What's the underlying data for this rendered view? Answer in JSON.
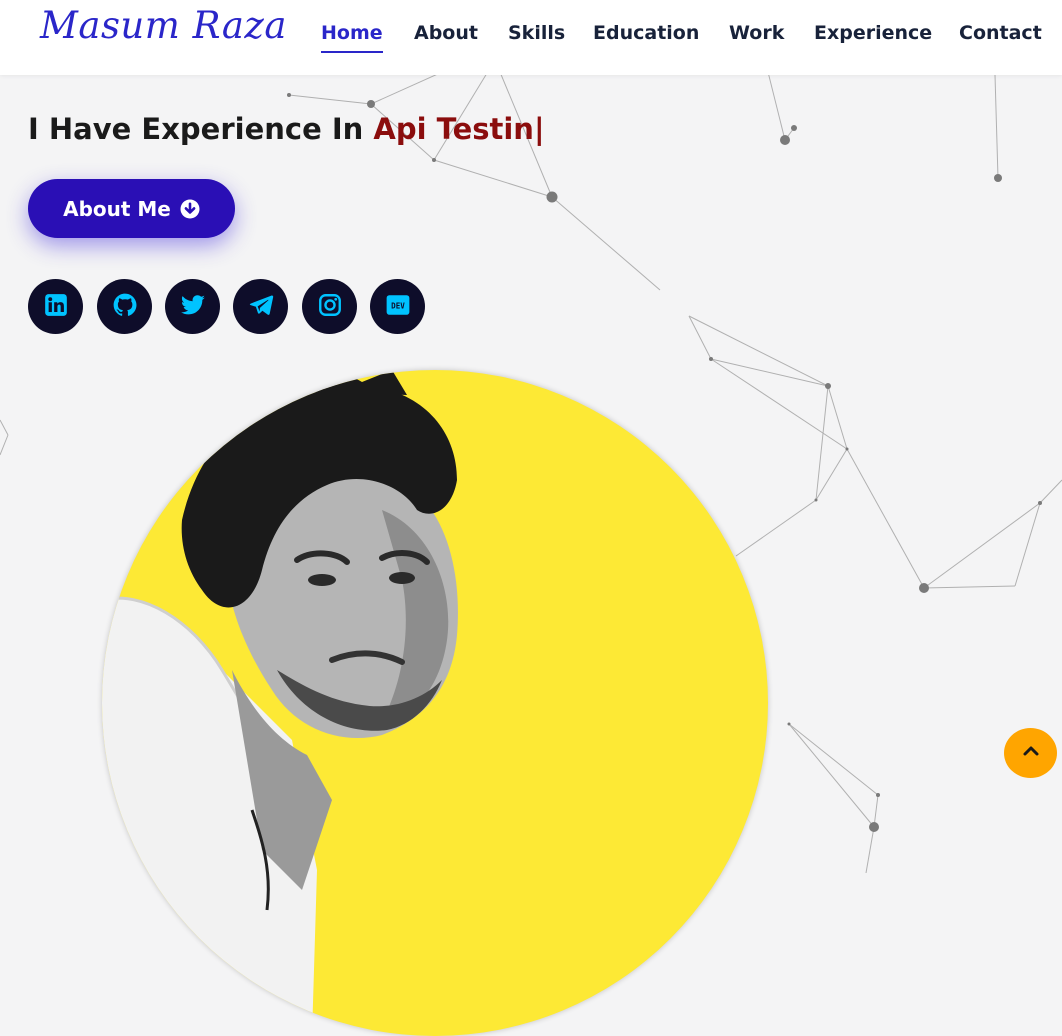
{
  "brand": {
    "name": "Masum Raza",
    "color": "#2a26c9"
  },
  "nav": {
    "items": [
      {
        "label": "Home",
        "active": true
      },
      {
        "label": "About",
        "active": false
      },
      {
        "label": "Skills",
        "active": false
      },
      {
        "label": "Education",
        "active": false
      },
      {
        "label": "Work",
        "active": false
      },
      {
        "label": "Experience",
        "active": false
      },
      {
        "label": "Contact",
        "active": false
      }
    ]
  },
  "hero": {
    "prefix": "I Have Experience In",
    "typed_text": "Api Testin",
    "cursor": "|",
    "button_label": "About Me",
    "button_icon": "arrow-circle-down-icon"
  },
  "socials": [
    {
      "name": "linkedin-icon"
    },
    {
      "name": "github-icon"
    },
    {
      "name": "twitter-icon"
    },
    {
      "name": "telegram-icon"
    },
    {
      "name": "instagram-icon"
    },
    {
      "name": "dev-icon",
      "text": "DEV"
    }
  ],
  "colors": {
    "accent": "#2a26c9",
    "button": "#2a0fb5",
    "typed": "#8b0d0d",
    "social_bg": "#0e0d2a",
    "social_icon": "#00c3ff",
    "photo_circle": "#fde935",
    "scroll_top": "#ffa500"
  },
  "scroll_top": {
    "icon": "chevron-up-icon"
  }
}
